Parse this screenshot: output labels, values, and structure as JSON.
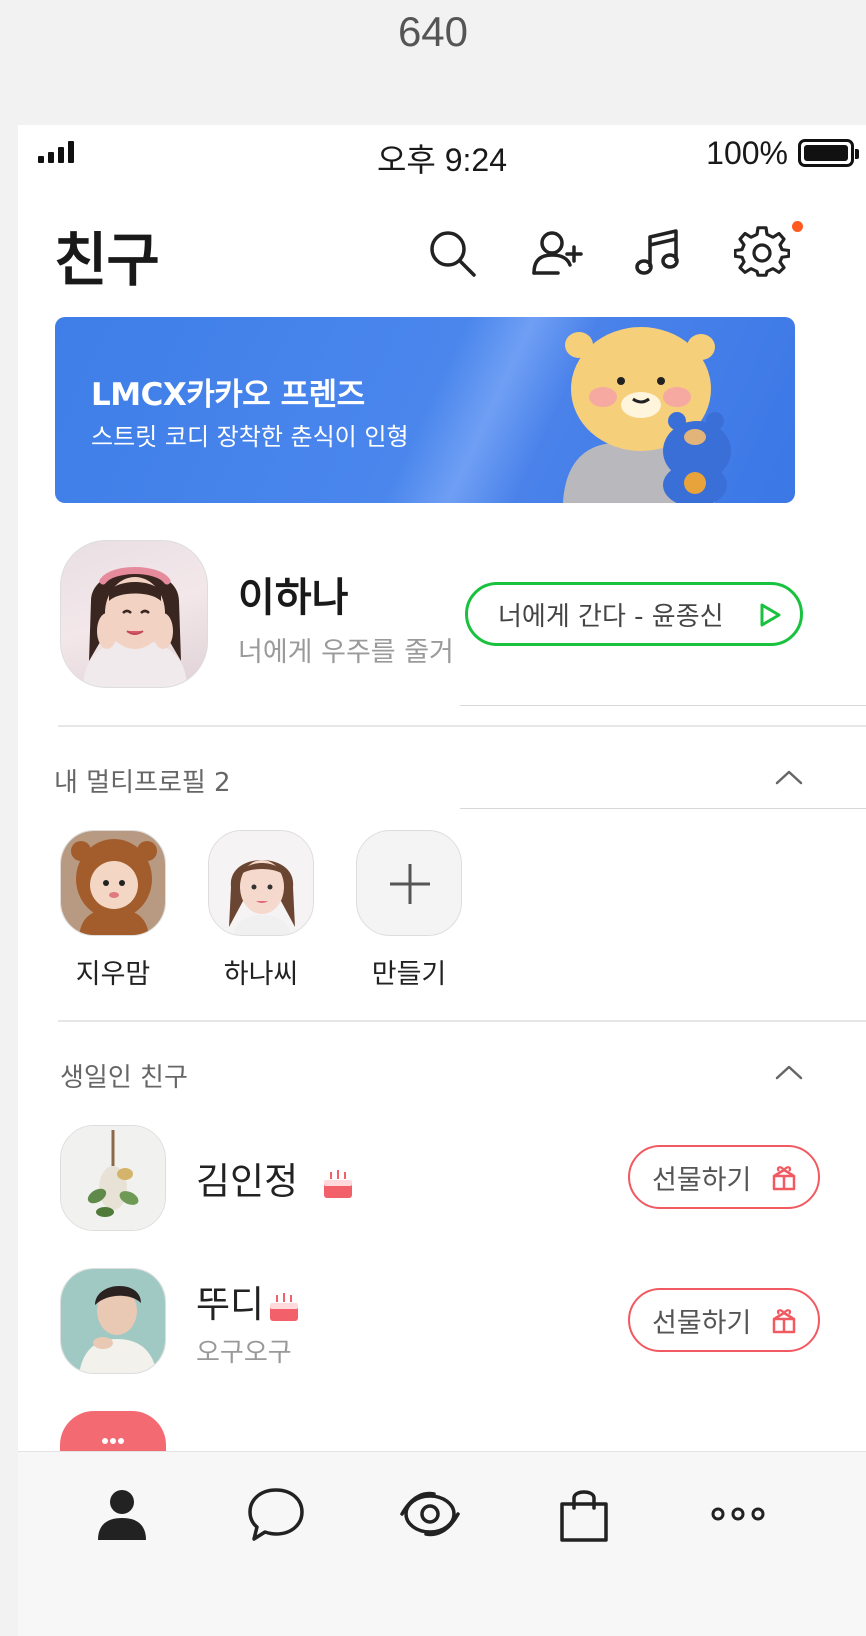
{
  "top_label": "640",
  "status_bar": {
    "time": "오후 9:24",
    "battery_percent": "100%"
  },
  "header": {
    "title": "친구"
  },
  "banner": {
    "title": "LMCX카카오 프렌즈",
    "subtitle": "스트릿 코디 장착한 춘식이 인형"
  },
  "my_profile": {
    "name": "이하나",
    "status_message": "너에게 우주를 줄거",
    "music": "너에게 간다 - 윤종신"
  },
  "multi_profile": {
    "title": "내 멀티프로필 2",
    "items": [
      {
        "label": "지우맘"
      },
      {
        "label": "하나씨"
      },
      {
        "label": "만들기"
      }
    ]
  },
  "birthday": {
    "title": "생일인 친구",
    "friends": [
      {
        "name": "김인정",
        "sub": "",
        "button": "선물하기"
      },
      {
        "name": "뚜디",
        "sub": "오구오구",
        "button": "선물하기"
      }
    ]
  },
  "colors": {
    "accent_green": "#19c23e",
    "gift_red": "#f25a62",
    "banner_blue": "#3f7ee8",
    "notification_dot": "#ff5a1f"
  },
  "tabs": [
    "friends-tab",
    "chats-tab",
    "view-tab",
    "shopping-tab",
    "more-tab"
  ]
}
